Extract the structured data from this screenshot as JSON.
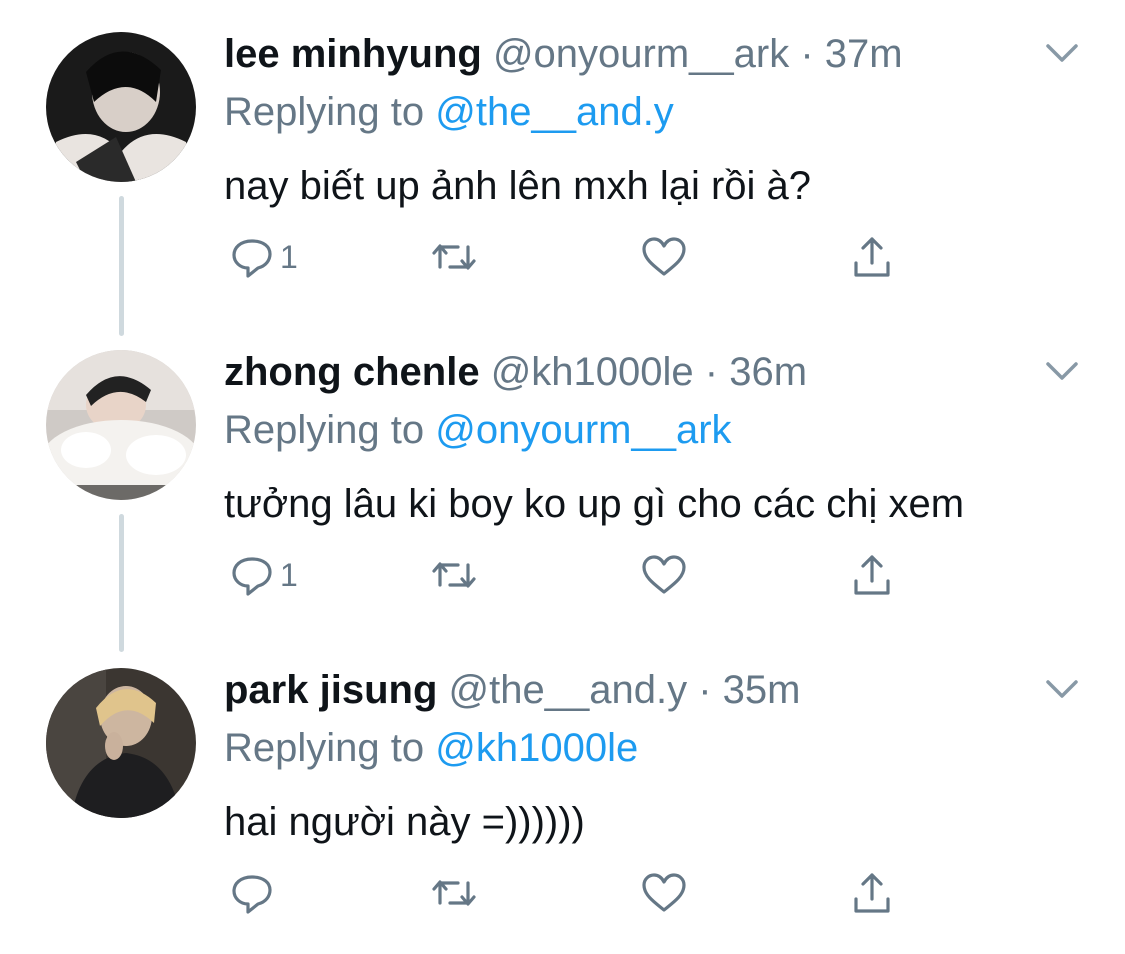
{
  "colors": {
    "name": "#0f1419",
    "meta": "#657786",
    "mention": "#1d9bf0",
    "thread_line": "#cfd9de"
  },
  "tweets": [
    {
      "name": "lee minhyung",
      "handle": "@onyourm__ark",
      "time": "37m",
      "replying_prefix": "Replying to",
      "replying_to": "@the__and.y",
      "text": "nay biết up ảnh lên mxh lại rồi à?",
      "reply_count": "1",
      "icons": [
        "reply-icon",
        "retweet-icon",
        "like-icon",
        "share-icon",
        "chevron-down-icon"
      ]
    },
    {
      "name": "zhong chenle",
      "handle": "@kh1000le",
      "time": "36m",
      "replying_prefix": "Replying to",
      "replying_to": "@onyourm__ark",
      "text": "tưởng lâu ki boy ko up gì cho các chị xem",
      "reply_count": "1",
      "icons": [
        "reply-icon",
        "retweet-icon",
        "like-icon",
        "share-icon",
        "chevron-down-icon"
      ]
    },
    {
      "name": "park jisung",
      "handle": "@the__and.y",
      "time": "35m",
      "replying_prefix": "Replying to",
      "replying_to": "@kh1000le",
      "text": "hai người này =))))))",
      "reply_count": "",
      "icons": [
        "reply-icon",
        "retweet-icon",
        "like-icon",
        "share-icon",
        "chevron-down-icon"
      ]
    }
  ]
}
